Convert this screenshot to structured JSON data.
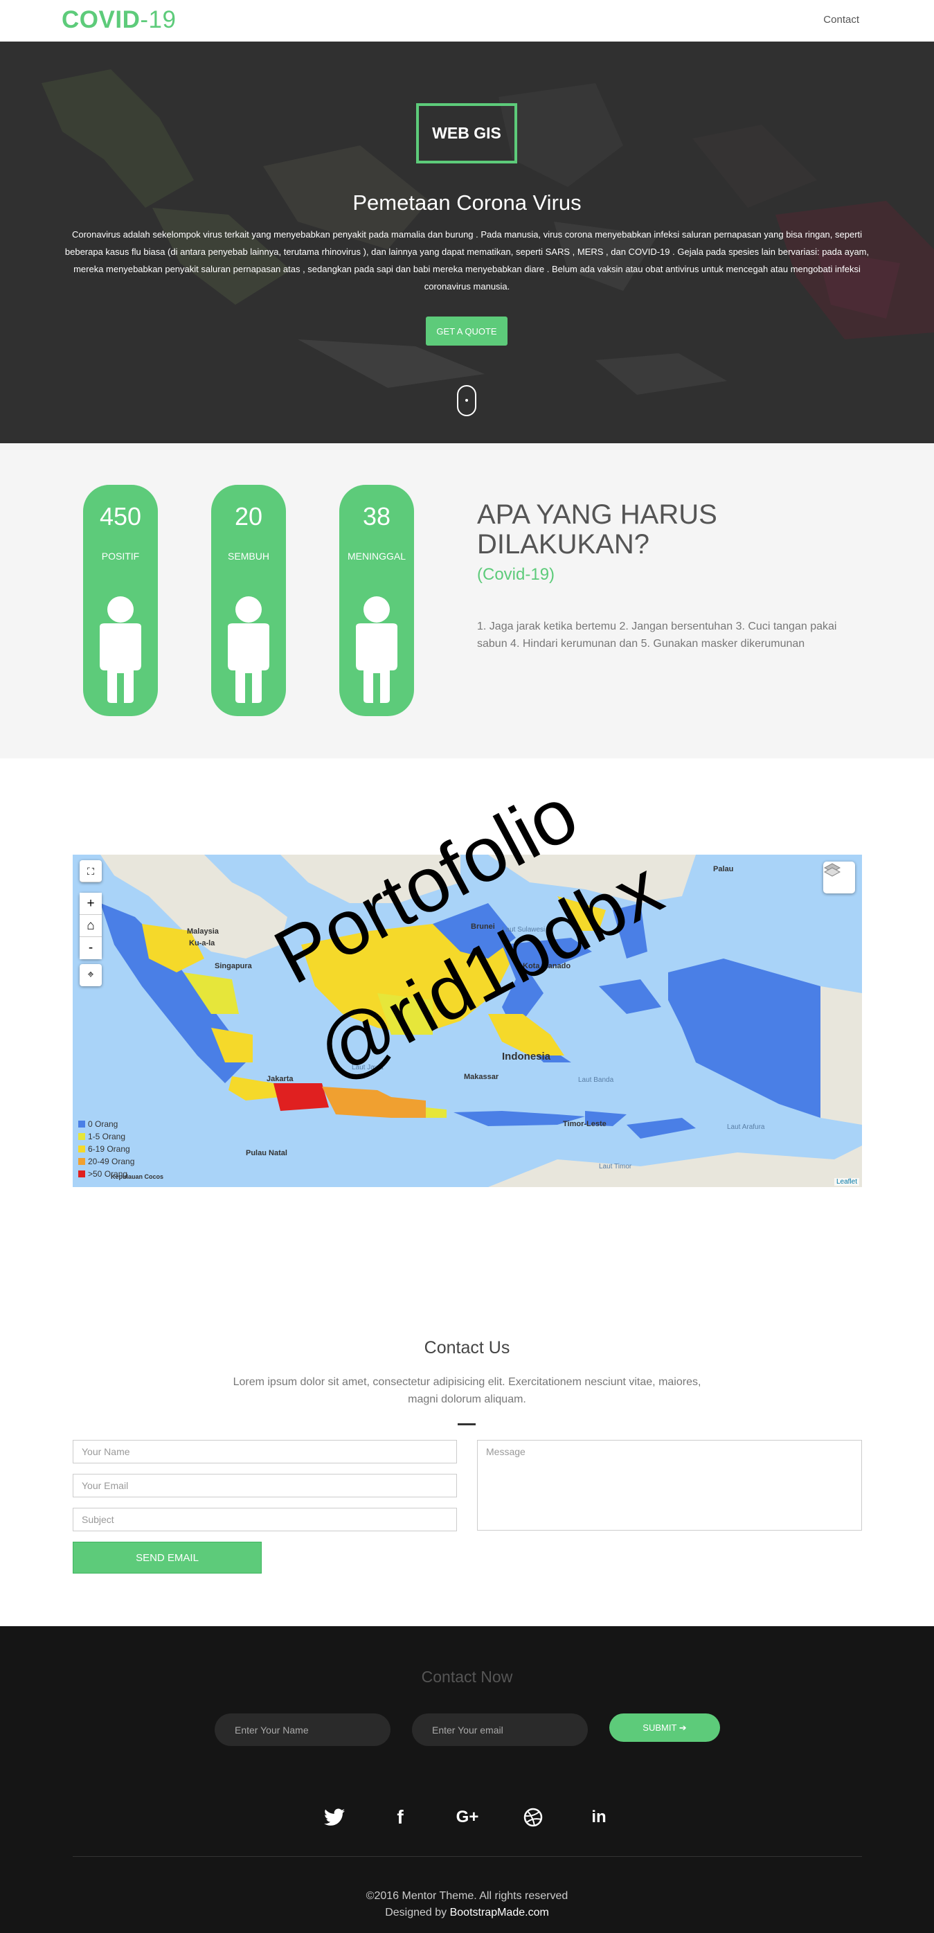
{
  "navbar": {
    "brand_part1": "COVID",
    "brand_part2": "-19",
    "contact_link": "Contact"
  },
  "hero": {
    "badge": "WEB GIS",
    "title": "Pemetaan Corona Virus",
    "text": "Coronavirus adalah sekelompok virus terkait yang menyebabkan penyakit pada mamalia dan burung . Pada manusia, virus corona menyebabkan infeksi saluran pernapasan yang bisa ringan, seperti beberapa kasus flu biasa (di antara penyebab lainnya, terutama rhinovirus ), dan lainnya yang dapat mematikan, seperti SARS , MERS , dan COVID-19 . Gejala pada spesies lain bervariasi: pada ayam, mereka menyebabkan penyakit saluran pernapasan atas , sedangkan pada sapi dan babi mereka menyebabkan diare . Belum ada vaksin atau obat antivirus untuk mencegah atau mengobati infeksi coronavirus manusia.",
    "button": "GET A QUOTE"
  },
  "stats": {
    "cards": [
      {
        "value": "450",
        "label": "POSITIF"
      },
      {
        "value": "20",
        "label": "SEMBUH"
      },
      {
        "value": "38",
        "label": "MENINGGAL"
      }
    ],
    "title": "APA YANG HARUS DILAKUKAN?",
    "subtitle": "(Covid-19)",
    "text": "1. Jaga jarak ketika bertemu 2. Jangan bersentuhan 3. Cuci tangan pakai sabun 4. Hindari kerumunan dan 5. Gunakan masker dikerumunan"
  },
  "watermark": {
    "line1": "Portofolio",
    "line2": "@rid1bdbx"
  },
  "map": {
    "zoom_in": "+",
    "zoom_out": "-",
    "home": "⌂",
    "fullscreen": "⛶",
    "locate": "⌖",
    "legend": [
      {
        "label": "0 Orang",
        "color": "#4a7fe6"
      },
      {
        "label": "1-5 Orang",
        "color": "#e6e63a"
      },
      {
        "label": "6-19 Orang",
        "color": "#f5d92a"
      },
      {
        "label": "20-49 Orang",
        "color": "#f0a030"
      },
      {
        "label": ">50 Orang",
        "color": "#e02020"
      }
    ],
    "labels": {
      "malaysia": "Malaysia",
      "kuala": "Ku-a-la",
      "singapura": "Singapura",
      "brunei": "Brunei",
      "kota_manado": "Kota Manado",
      "indonesia": "Indonesia",
      "jakarta": "Jakarta",
      "makassar": "Makassar",
      "timor_leste": "Timor-Leste",
      "pulau_natal": "Pulau Natal",
      "kepulauan_cocos": "Kepulauan Cocos",
      "palau": "Palau",
      "laut_jawa": "Laut Jawa",
      "laut_banda": "Laut Banda",
      "laut_arafura": "Laut Arafura",
      "laut_timor": "Laut Timor",
      "laut_sulawesi": "Laut Sulawesi"
    },
    "attribution": "Leaflet"
  },
  "contact": {
    "title": "Contact Us",
    "text": "Lorem ipsum dolor sit amet, consectetur adipisicing elit. Exercitationem nesciunt vitae, maiores, magni dolorum aliquam.",
    "name_placeholder": "Your Name",
    "email_placeholder": "Your Email",
    "subject_placeholder": "Subject",
    "message_placeholder": "Message",
    "send_button": "SEND EMAIL"
  },
  "footer": {
    "contact_now": "Contact Now",
    "name_placeholder": "Enter Your Name",
    "email_placeholder": "Enter Your email",
    "submit": "SUBMIT",
    "copyright": "©2016 Mentor Theme. All rights reserved",
    "designed_by": "Designed by",
    "designer": "BootstrapMade.com"
  },
  "colors": {
    "accent": "#5dcb7a",
    "footer_bg": "#151515",
    "stats_bg": "#f5f5f5"
  }
}
